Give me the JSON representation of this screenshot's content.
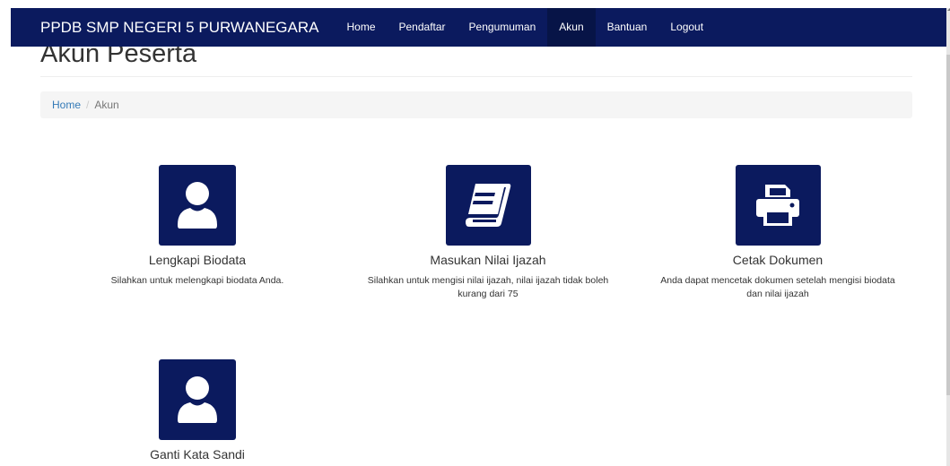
{
  "navbar": {
    "brand": "PPDB SMP NEGERI 5 PURWANEGARA",
    "items": [
      {
        "label": "Home"
      },
      {
        "label": "Pendaftar"
      },
      {
        "label": "Pengumuman"
      },
      {
        "label": "Akun"
      },
      {
        "label": "Bantuan"
      },
      {
        "label": "Logout"
      }
    ],
    "active": "Akun"
  },
  "page": {
    "title": "Akun Peserta"
  },
  "breadcrumb": {
    "home": "Home",
    "separator": "/",
    "current": "Akun"
  },
  "cards": [
    {
      "icon": "user-icon",
      "title": "Lengkapi Biodata",
      "desc": "Silahkan untuk melengkapi biodata Anda."
    },
    {
      "icon": "book-icon",
      "title": "Masukan Nilai Ijazah",
      "desc": "Silahkan untuk mengisi nilai ijazah, nilai ijazah tidak boleh kurang dari 75"
    },
    {
      "icon": "print-icon",
      "title": "Cetak Dokumen",
      "desc": "Anda dapat mencetak dokumen setelah mengisi biodata dan nilai ijazah"
    },
    {
      "icon": "user-icon",
      "title": "Ganti Kata Sandi",
      "desc": ""
    }
  ],
  "colors": {
    "navbar": "#0b1a5e",
    "nav_active": "#071447",
    "icon_box": "#0b1a5e",
    "link": "#337ab7",
    "breadcrumb_bg": "#f5f5f5"
  }
}
